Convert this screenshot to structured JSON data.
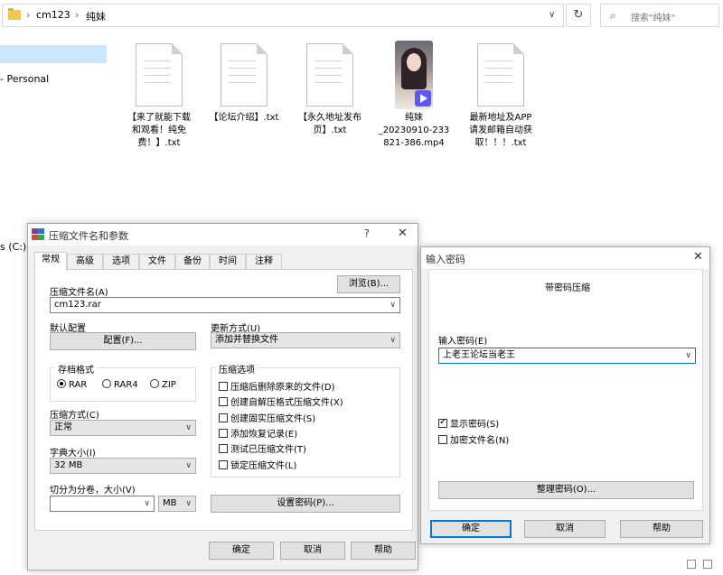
{
  "explorer": {
    "breadcrumb": [
      "cm123",
      "纯妹"
    ],
    "search_placeholder": "搜索\"纯妹\"",
    "nav": {
      "personal": "- Personal",
      "drive": "s (C:)"
    },
    "files": [
      {
        "name": "【来了就能下载和观看！纯免费！】.txt",
        "lines": [
          "【来了就能下载",
          "和观看！纯免",
          "费！】.txt"
        ],
        "kind": "txt"
      },
      {
        "name": "【论坛介绍】.txt",
        "lines": [
          "【论坛介绍】.txt"
        ],
        "kind": "txt"
      },
      {
        "name": "【永久地址发布页】.txt",
        "lines": [
          "【永久地址发布",
          "页】.txt"
        ],
        "kind": "txt"
      },
      {
        "name": "纯妹_20230910-233821-386.mp4",
        "lines": [
          "纯妹",
          "_20230910-233",
          "821-386.mp4"
        ],
        "kind": "video"
      },
      {
        "name": "最新地址及APP请发邮箱自动获取！！！.txt",
        "lines": [
          "最新地址及APP",
          "请发邮箱自动获",
          "取！！！.txt"
        ],
        "kind": "txt"
      }
    ]
  },
  "rar_dialog": {
    "title": "压缩文件名和参数",
    "help": "?",
    "close": "✕",
    "tabs": [
      "常规",
      "高级",
      "选项",
      "文件",
      "备份",
      "时间",
      "注释"
    ],
    "archive_name_label": "压缩文件名(A)",
    "browse_button": "浏览(B)...",
    "archive_name_value": "cm123.rar",
    "default_config_label": "默认配置",
    "config_button": "配置(F)...",
    "update_method_label": "更新方式(U)",
    "update_method_value": "添加并替换文件",
    "format_group": "存档格式",
    "formats": [
      {
        "label": "RAR",
        "selected": true
      },
      {
        "label": "RAR4",
        "selected": false
      },
      {
        "label": "ZIP",
        "selected": false
      }
    ],
    "compression_method_label": "压缩方式(C)",
    "compression_method_value": "正常",
    "dictionary_label": "字典大小(I)",
    "dictionary_value": "32 MB",
    "split_label": "切分为分卷，大小(V)",
    "split_value": "",
    "split_unit": "MB",
    "options_group": "压缩选项",
    "options": [
      {
        "label": "压缩后删除原来的文件(D)",
        "checked": false
      },
      {
        "label": "创建自解压格式压缩文件(X)",
        "checked": false
      },
      {
        "label": "创建固实压缩文件(S)",
        "checked": false
      },
      {
        "label": "添加恢复记录(E)",
        "checked": false
      },
      {
        "label": "测试已压缩文件(T)",
        "checked": false
      },
      {
        "label": "锁定压缩文件(L)",
        "checked": false
      }
    ],
    "set_password_button": "设置密码(P)...",
    "ok_button": "确定",
    "cancel_button": "取消",
    "help_button": "帮助"
  },
  "password_dialog": {
    "title": "输入密码",
    "close": "✕",
    "heading": "带密码压缩",
    "enter_password_label": "输入密码(E)",
    "password_value": "上老王论坛当老王",
    "show_password": {
      "label": "显示密码(S)",
      "checked": true
    },
    "encrypt_names": {
      "label": "加密文件名(N)",
      "checked": false
    },
    "organize_button": "整理密码(O)...",
    "ok_button": "确定",
    "cancel_button": "取消",
    "help_button": "帮助"
  }
}
